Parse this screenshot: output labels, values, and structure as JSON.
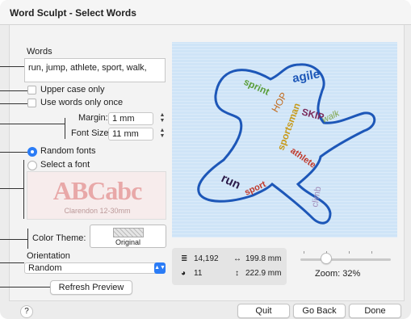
{
  "window": {
    "title": "Word Sculpt - Select Words"
  },
  "words": {
    "label": "Words",
    "value": "run, jump, athlete, sport, walk,"
  },
  "options": {
    "upper_case": "Upper case only",
    "words_once": "Use words only once"
  },
  "margin": {
    "label": "Margin:",
    "value": "1 mm"
  },
  "font_size": {
    "label": "Font Size:",
    "value": "11 mm"
  },
  "fonts": {
    "random": "Random fonts",
    "select": "Select a font",
    "preview_text": "ABCabc",
    "preview_caption": "Clarendon 12-30mm"
  },
  "color_theme": {
    "label": "Color Theme:",
    "value": "Original"
  },
  "orientation": {
    "label": "Orientation",
    "value": "Random"
  },
  "refresh_button": "Refresh Preview",
  "stats": {
    "stitches": "14,192",
    "width": "199.8 mm",
    "colors": "11",
    "height": "222.9 mm"
  },
  "zoom": {
    "label": "Zoom: 32%",
    "value": 32
  },
  "sculpt_words": {
    "w1": "agile",
    "w2": "sprint",
    "w3": "HOP",
    "w4": "SKIP",
    "w5": "walk",
    "w6": "sportsman",
    "w7": "athlete",
    "w8": "run",
    "w9": "sport",
    "w10": "climb"
  },
  "colors": {
    "accent": "#2b7cf6",
    "outline": "#1d57b8"
  },
  "footer": {
    "help": "?",
    "quit": "Quit",
    "go_back": "Go Back",
    "done": "Done"
  }
}
